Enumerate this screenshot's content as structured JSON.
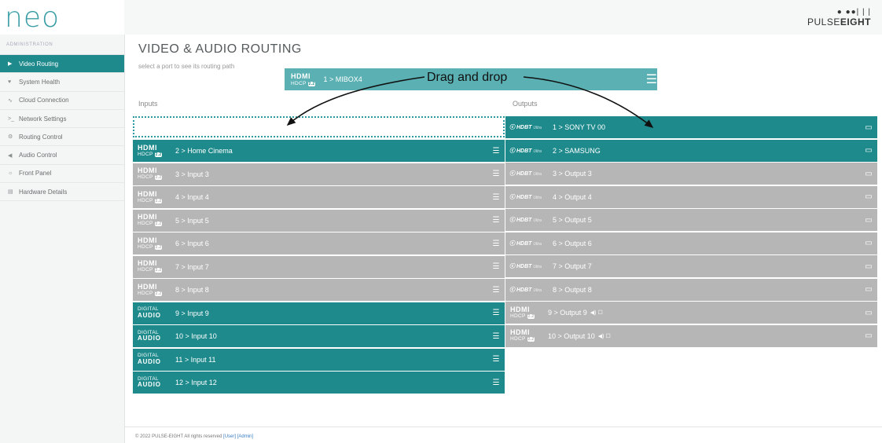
{
  "app": {
    "logo": "neo",
    "brand": {
      "dots": "● ●●| | |",
      "name_light": "PULSE",
      "name_bold": "EIGHT"
    }
  },
  "sidebar": {
    "header": "ADMINISTRATION",
    "items": [
      {
        "label": "Video Routing",
        "icon": "video-icon",
        "glyph": "▶",
        "active": true
      },
      {
        "label": "System Health",
        "icon": "heart-icon",
        "glyph": "♥",
        "active": false
      },
      {
        "label": "Cloud Connection",
        "icon": "wifi-icon",
        "glyph": "∿",
        "active": false
      },
      {
        "label": "Network Settings",
        "icon": "terminal-icon",
        "glyph": ">_",
        "active": false
      },
      {
        "label": "Routing Control",
        "icon": "gears-icon",
        "glyph": "⚙",
        "active": false
      },
      {
        "label": "Audio Control",
        "icon": "speaker-icon",
        "glyph": "◀",
        "active": false
      },
      {
        "label": "Front Panel",
        "icon": "sun-icon",
        "glyph": "☼",
        "active": false
      },
      {
        "label": "Hardware Details",
        "icon": "chip-icon",
        "glyph": "▤",
        "active": false
      }
    ]
  },
  "main": {
    "title": "VIDEO & AUDIO ROUTING",
    "subtitle": "select a port to see its routing path",
    "inputs_label": "Inputs",
    "outputs_label": "Outputs",
    "dragging": {
      "label": "1 > MIBOX4",
      "logo_top": "HDMI",
      "logo_bottom": "HDCP"
    },
    "annotation": "Drag and drop"
  },
  "inputs": [
    {
      "label": "2 > Home Cinema",
      "type": "hdmi",
      "state": "teal"
    },
    {
      "label": "3 > Input 3",
      "type": "hdmi",
      "state": "grey"
    },
    {
      "label": "4 > Input 4",
      "type": "hdmi",
      "state": "grey"
    },
    {
      "label": "5 > Input 5",
      "type": "hdmi",
      "state": "grey"
    },
    {
      "label": "6 > Input 6",
      "type": "hdmi",
      "state": "grey"
    },
    {
      "label": "7 > Input 7",
      "type": "hdmi",
      "state": "grey"
    },
    {
      "label": "8 > Input 8",
      "type": "hdmi",
      "state": "grey"
    },
    {
      "label": "9 > Input 9",
      "type": "digital",
      "state": "teal"
    },
    {
      "label": "10 > Input 10",
      "type": "digital",
      "state": "teal"
    },
    {
      "label": "11 > Input 11",
      "type": "digital",
      "state": "teal"
    },
    {
      "label": "12 > Input 12",
      "type": "digital",
      "state": "teal"
    }
  ],
  "outputs": [
    {
      "label": "1 > SONY TV 00",
      "type": "hdbt",
      "state": "teal"
    },
    {
      "label": "2 > SAMSUNG",
      "type": "hdbt",
      "state": "teal"
    },
    {
      "label": "3 > Output 3",
      "type": "hdbt",
      "state": "grey"
    },
    {
      "label": "4 > Output 4",
      "type": "hdbt",
      "state": "grey"
    },
    {
      "label": "5 > Output 5",
      "type": "hdbt",
      "state": "grey"
    },
    {
      "label": "6 > Output 6",
      "type": "hdbt",
      "state": "grey"
    },
    {
      "label": "7 > Output 7",
      "type": "hdbt",
      "state": "grey"
    },
    {
      "label": "8 > Output 8",
      "type": "hdbt",
      "state": "grey"
    },
    {
      "label": "9 > Output 9",
      "type": "hdmi",
      "state": "grey",
      "extra": true
    },
    {
      "label": "10 > Output 10",
      "type": "hdmi",
      "state": "grey",
      "extra": true
    }
  ],
  "logos": {
    "hdmi": "HDMI",
    "hdcp": "HDCP",
    "hdcp_badge": "2.2",
    "hdbt": "HDBT",
    "hdbt_sub": "Ultra",
    "digital": "DIGITAL",
    "audio": "AUDIO"
  },
  "footer": {
    "text": "© 2022 PULSE-EIGHT All rights reserved",
    "user_link": "[User]",
    "admin_link": "[Admin]"
  },
  "colors": {
    "teal": "#1e8a8c",
    "grey": "#b6b6b6",
    "drag_tile": "#5ab0b2",
    "logo": "#3b9ea6"
  }
}
